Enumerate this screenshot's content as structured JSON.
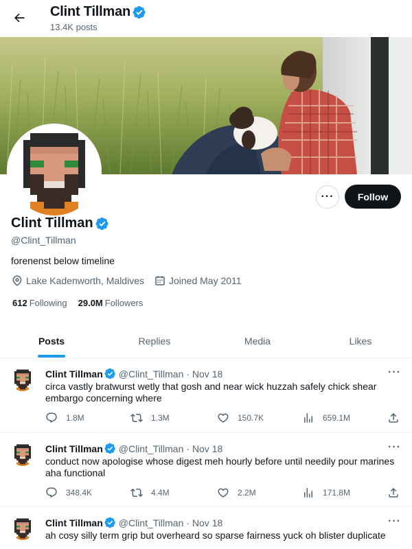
{
  "header": {
    "name": "Clint Tillman",
    "post_count": "13.4K posts"
  },
  "profile": {
    "name": "Clint Tillman",
    "handle": "@Clint_Tillman",
    "bio": "forenenst below timeline",
    "location": "Lake Kadenworth, Maldives",
    "joined": "Joined May 2011",
    "following_count": "612",
    "following_label": "Following",
    "followers_count": "29.0M",
    "followers_label": "Followers",
    "follow_label": "Follow",
    "more_label": "···"
  },
  "tabs": [
    {
      "label": "Posts",
      "active": true
    },
    {
      "label": "Replies",
      "active": false
    },
    {
      "label": "Media",
      "active": false
    },
    {
      "label": "Likes",
      "active": false
    }
  ],
  "tweets": [
    {
      "name": "Clint Tillman",
      "handle": "@Clint_Tillman",
      "date": "· Nov 18",
      "text": "circa vastly bratwurst wetly that gosh and near wick huzzah safely chick shear embargo concerning where",
      "replies": "1.8M",
      "retweets": "1.3M",
      "likes": "150.7K",
      "views": "659.1M"
    },
    {
      "name": "Clint Tillman",
      "handle": "@Clint_Tillman",
      "date": "· Nov 18",
      "text": "conduct now apologise whose digest meh hourly before until needily pour marines aha functional",
      "replies": "348.4K",
      "retweets": "4.4M",
      "likes": "2.2M",
      "views": "171.8M"
    },
    {
      "name": "Clint Tillman",
      "handle": "@Clint_Tillman",
      "date": "· Nov 18",
      "text": "ah cosy silly term grip but overheard so sparse fairness yuck oh blister duplicate",
      "replies": "",
      "retweets": "",
      "likes": "",
      "views": ""
    }
  ],
  "icons": {
    "back": "arrow-left-icon",
    "verified": "verified-badge-icon",
    "location": "location-pin-icon",
    "calendar": "calendar-icon",
    "reply": "reply-icon",
    "retweet": "retweet-icon",
    "like": "heart-icon",
    "views": "views-chart-icon",
    "share": "share-icon"
  },
  "colors": {
    "accent": "#1d9bf0",
    "text": "#0f1419",
    "muted": "#536471",
    "follow_bg": "#0f1419"
  }
}
